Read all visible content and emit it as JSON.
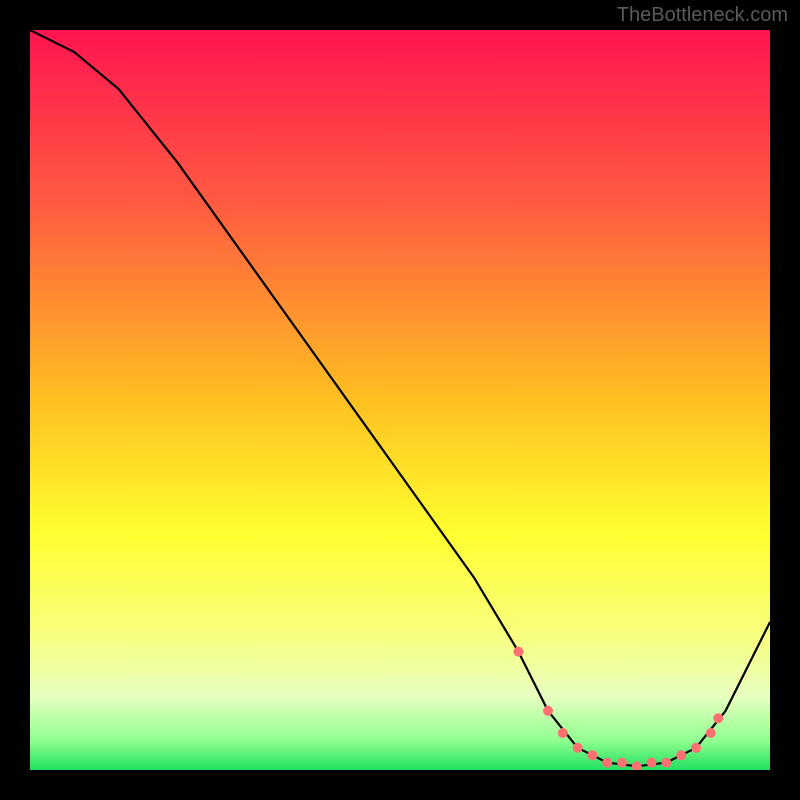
{
  "watermark": "TheBottleneck.com",
  "chart_data": {
    "type": "line",
    "title": "",
    "xlabel": "",
    "ylabel": "",
    "xlim": [
      0,
      100
    ],
    "ylim": [
      0,
      100
    ],
    "gradient_stops": [
      {
        "offset": 0,
        "color": "#ff1450"
      },
      {
        "offset": 0.25,
        "color": "#ff6040"
      },
      {
        "offset": 0.5,
        "color": "#ffc020"
      },
      {
        "offset": 0.68,
        "color": "#ffff30"
      },
      {
        "offset": 0.82,
        "color": "#f8ff80"
      },
      {
        "offset": 0.9,
        "color": "#e8ffc0"
      },
      {
        "offset": 0.96,
        "color": "#90ff90"
      },
      {
        "offset": 1.0,
        "color": "#20e060"
      }
    ],
    "series": [
      {
        "name": "bottleneck-curve",
        "color": "#000000",
        "x": [
          0,
          6,
          12,
          20,
          30,
          40,
          50,
          60,
          66,
          70,
          74,
          78,
          82,
          86,
          90,
          94,
          100
        ],
        "values": [
          100,
          97,
          92,
          82,
          68,
          54,
          40,
          26,
          16,
          8,
          3,
          1,
          0.5,
          1,
          3,
          8,
          20
        ]
      }
    ],
    "markers": {
      "name": "highlight-points",
      "color": "#ff7070",
      "radius": 5,
      "x": [
        66,
        70,
        72,
        74,
        76,
        78,
        80,
        82,
        84,
        86,
        88,
        90,
        92,
        93
      ],
      "values": [
        16,
        8,
        5,
        3,
        2,
        1,
        1,
        0.5,
        1,
        1,
        2,
        3,
        5,
        7
      ]
    }
  }
}
